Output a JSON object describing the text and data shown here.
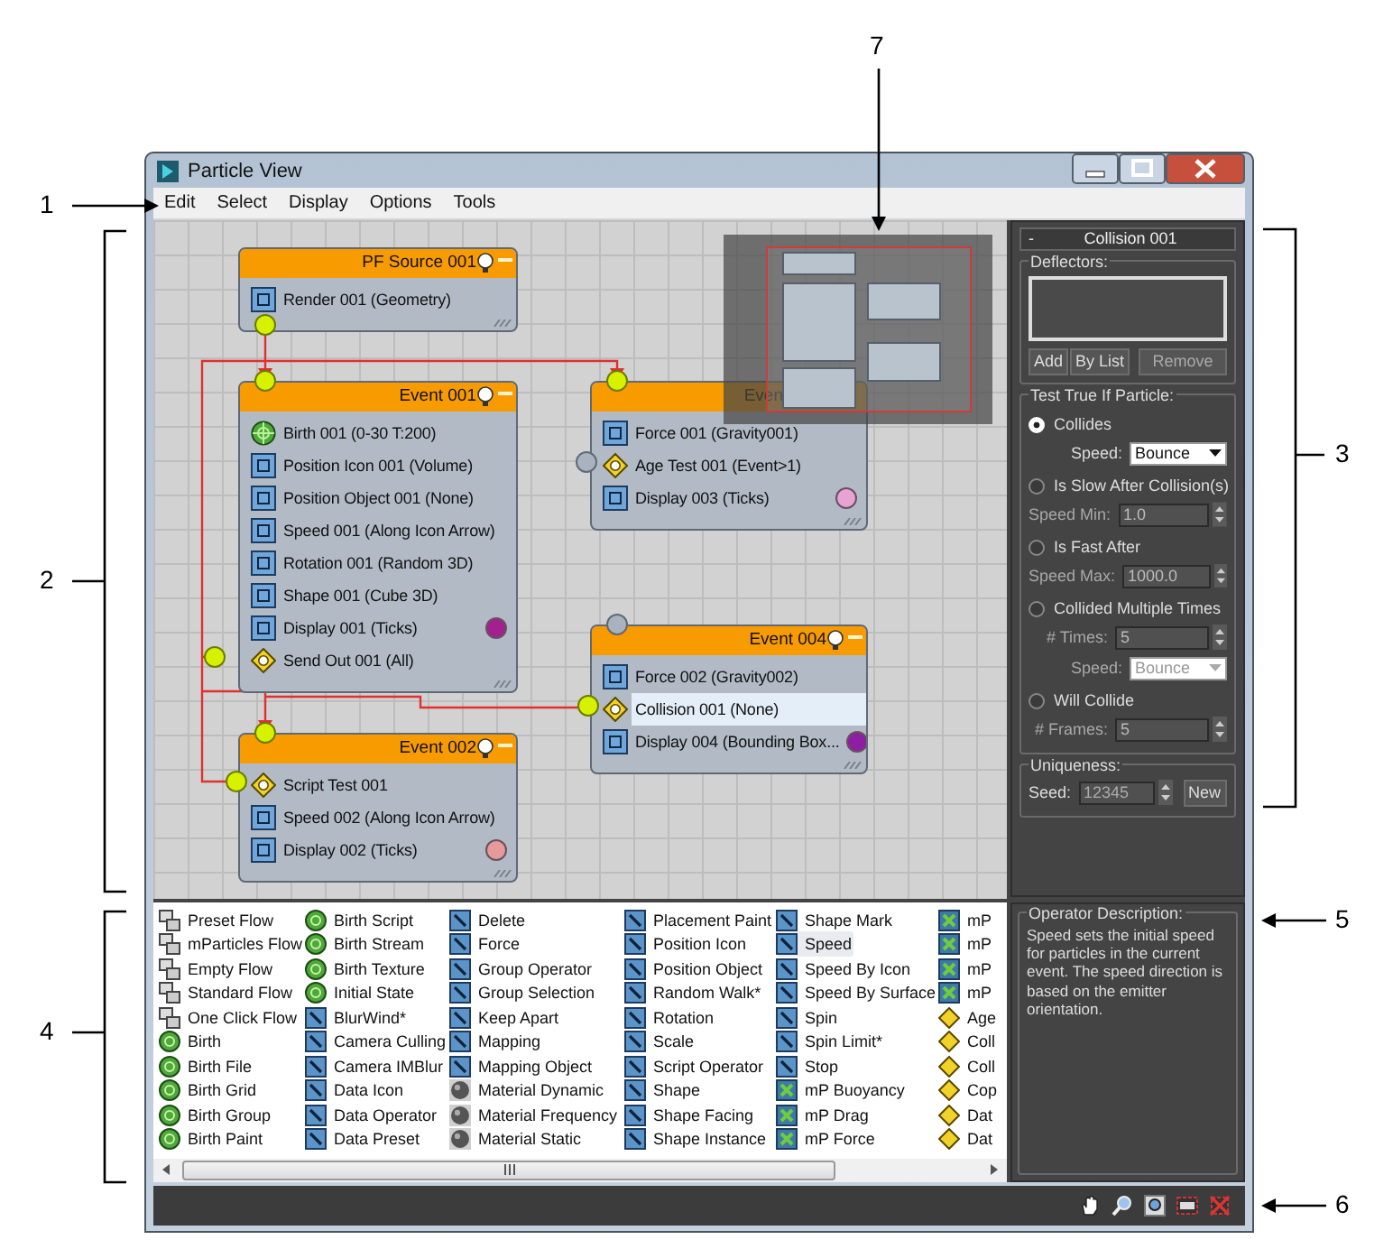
{
  "callouts": [
    {
      "label": "1"
    },
    {
      "label": "2"
    },
    {
      "label": "3"
    },
    {
      "label": "4"
    },
    {
      "label": "5"
    },
    {
      "label": "6"
    },
    {
      "label": "7"
    }
  ],
  "window": {
    "title": "Particle View"
  },
  "menu": [
    "Edit",
    "Select",
    "Display",
    "Options",
    "Tools"
  ],
  "nodes": [
    {
      "title": "PF Source 001",
      "rows": [
        {
          "label": "Render 001 (Geometry)",
          "kind": "operator",
          "selected": false
        }
      ]
    },
    {
      "title": "Event 001",
      "rows": [
        {
          "label": "Birth 001 (0-30 T:200)",
          "kind": "birth",
          "selected": false
        },
        {
          "label": "Position Icon 001 (Volume)",
          "kind": "operator",
          "selected": false
        },
        {
          "label": "Position Object 001 (None)",
          "kind": "operator",
          "selected": false
        },
        {
          "label": "Speed 001 (Along Icon Arrow)",
          "kind": "operator",
          "selected": false
        },
        {
          "label": "Rotation 001 (Random 3D)",
          "kind": "operator",
          "selected": false
        },
        {
          "label": "Shape 001 (Cube 3D)",
          "kind": "operator",
          "selected": false
        },
        {
          "label": "Display 001 (Ticks)",
          "kind": "operator",
          "selected": false,
          "color": "#a3208e"
        },
        {
          "label": "Send Out 001 (All)",
          "kind": "test",
          "selected": false
        }
      ]
    },
    {
      "title": "Even",
      "rows": [
        {
          "label": "Force 001 (Gravity001)",
          "kind": "operator",
          "selected": false
        },
        {
          "label": "Age Test 001 (Event>1)",
          "kind": "test",
          "selected": false
        },
        {
          "label": "Display 003 (Ticks)",
          "kind": "operator",
          "selected": false,
          "color": "#e6a3d3"
        }
      ]
    },
    {
      "title": "Event 004",
      "rows": [
        {
          "label": "Force 002 (Gravity002)",
          "kind": "operator",
          "selected": false
        },
        {
          "label": "Collision 001 (None)",
          "kind": "test",
          "selected": true
        },
        {
          "label": "Display 004 (Bounding Box...",
          "kind": "operator",
          "selected": false,
          "color": "#8e1fa3"
        }
      ]
    },
    {
      "title": "Event 002",
      "rows": [
        {
          "label": "Script Test 001",
          "kind": "test",
          "selected": false
        },
        {
          "label": "Speed 002 (Along Icon Arrow)",
          "kind": "operator",
          "selected": false
        },
        {
          "label": "Display 002 (Ticks)",
          "kind": "operator",
          "selected": false,
          "color": "#e69a9a"
        }
      ]
    }
  ],
  "depot": {
    "columns": [
      [
        {
          "label": "Preset Flow",
          "selected": false
        },
        {
          "label": "mParticles Flow",
          "selected": false
        },
        {
          "label": "Empty Flow",
          "selected": false
        },
        {
          "label": "Standard Flow",
          "selected": false
        },
        {
          "label": "One Click Flow",
          "selected": false
        },
        {
          "label": "Birth",
          "selected": false
        },
        {
          "label": "Birth File",
          "selected": false
        },
        {
          "label": "Birth Grid",
          "selected": false
        },
        {
          "label": "Birth Group",
          "selected": false
        },
        {
          "label": "Birth Paint",
          "selected": false
        }
      ],
      [
        {
          "label": "Birth Script",
          "selected": false
        },
        {
          "label": "Birth Stream",
          "selected": false
        },
        {
          "label": "Birth Texture",
          "selected": false
        },
        {
          "label": "Initial State",
          "selected": false
        },
        {
          "label": "BlurWind*",
          "selected": false
        },
        {
          "label": "Camera Culling",
          "selected": false
        },
        {
          "label": "Camera IMBlur",
          "selected": false
        },
        {
          "label": "Data Icon",
          "selected": false
        },
        {
          "label": "Data Operator",
          "selected": false
        },
        {
          "label": "Data Preset",
          "selected": false
        }
      ],
      [
        {
          "label": "Delete",
          "selected": false
        },
        {
          "label": "Force",
          "selected": false
        },
        {
          "label": "Group Operator",
          "selected": false
        },
        {
          "label": "Group Selection",
          "selected": false
        },
        {
          "label": "Keep Apart",
          "selected": false
        },
        {
          "label": "Mapping",
          "selected": false
        },
        {
          "label": "Mapping Object",
          "selected": false
        },
        {
          "label": "Material Dynamic",
          "selected": false
        },
        {
          "label": "Material Frequency",
          "selected": false
        },
        {
          "label": "Material Static",
          "selected": false
        }
      ],
      [
        {
          "label": "Placement Paint",
          "selected": false
        },
        {
          "label": "Position Icon",
          "selected": false
        },
        {
          "label": "Position Object",
          "selected": false
        },
        {
          "label": "Random Walk*",
          "selected": false
        },
        {
          "label": "Rotation",
          "selected": false
        },
        {
          "label": "Scale",
          "selected": false
        },
        {
          "label": "Script Operator",
          "selected": false
        },
        {
          "label": "Shape",
          "selected": false
        },
        {
          "label": "Shape Facing",
          "selected": false
        },
        {
          "label": "Shape Instance",
          "selected": false
        }
      ],
      [
        {
          "label": "Shape Mark",
          "selected": false
        },
        {
          "label": "Speed",
          "selected": true
        },
        {
          "label": "Speed By Icon",
          "selected": false
        },
        {
          "label": "Speed By Surface",
          "selected": false
        },
        {
          "label": "Spin",
          "selected": false
        },
        {
          "label": "Spin Limit*",
          "selected": false
        },
        {
          "label": "Stop",
          "selected": false
        },
        {
          "label": "mP Buoyancy",
          "selected": false
        },
        {
          "label": "mP Drag",
          "selected": false
        },
        {
          "label": "mP Force",
          "selected": false
        }
      ],
      [
        {
          "label": "mP",
          "selected": false
        },
        {
          "label": "mP",
          "selected": false
        },
        {
          "label": "mP",
          "selected": false
        },
        {
          "label": "mP",
          "selected": false
        },
        {
          "label": "Age",
          "selected": false
        },
        {
          "label": "Coll",
          "selected": false
        },
        {
          "label": "Coll",
          "selected": false
        },
        {
          "label": "Cop",
          "selected": false
        },
        {
          "label": "Dat",
          "selected": false
        },
        {
          "label": "Dat",
          "selected": false
        }
      ]
    ]
  },
  "rollout": {
    "toggle": "-",
    "title": "Collision 001",
    "deflectors": {
      "label": "Deflectors:",
      "buttons": [
        "Add",
        "By List",
        "Remove"
      ]
    },
    "test": {
      "label": "Test True If Particle:",
      "options": [
        {
          "label": "Collides",
          "selected": true,
          "fields": [
            {
              "label": "Speed:",
              "kind": "dropdown",
              "value": "Bounce",
              "disabled": false
            }
          ]
        },
        {
          "label": "Is Slow After Collision(s)",
          "selected": false,
          "fields": [
            {
              "label": "Speed Min:",
              "kind": "spinner",
              "value": "1.0",
              "disabled": true
            }
          ]
        },
        {
          "label": "Is Fast After",
          "selected": false,
          "fields": [
            {
              "label": "Speed Max:",
              "kind": "spinner",
              "value": "1000.0",
              "disabled": true
            }
          ]
        },
        {
          "label": "Collided Multiple Times",
          "selected": false,
          "fields": [
            {
              "label": "# Times:",
              "kind": "spinner",
              "value": "5",
              "disabled": true
            },
            {
              "label": "Speed:",
              "kind": "dropdown",
              "value": "Bounce",
              "disabled": true
            }
          ]
        },
        {
          "label": "Will Collide",
          "selected": false,
          "fields": [
            {
              "label": "# Frames:",
              "kind": "spinner",
              "value": "5",
              "disabled": true
            }
          ]
        }
      ]
    },
    "uniqueness": {
      "label": "Uniqueness:",
      "seed_label": "Seed:",
      "seed": "12345",
      "button": "New"
    }
  },
  "description": {
    "label": "Operator Description:",
    "text": "Speed sets the initial speed for particles in the current event. The speed direction is based on the emitter orientation."
  }
}
